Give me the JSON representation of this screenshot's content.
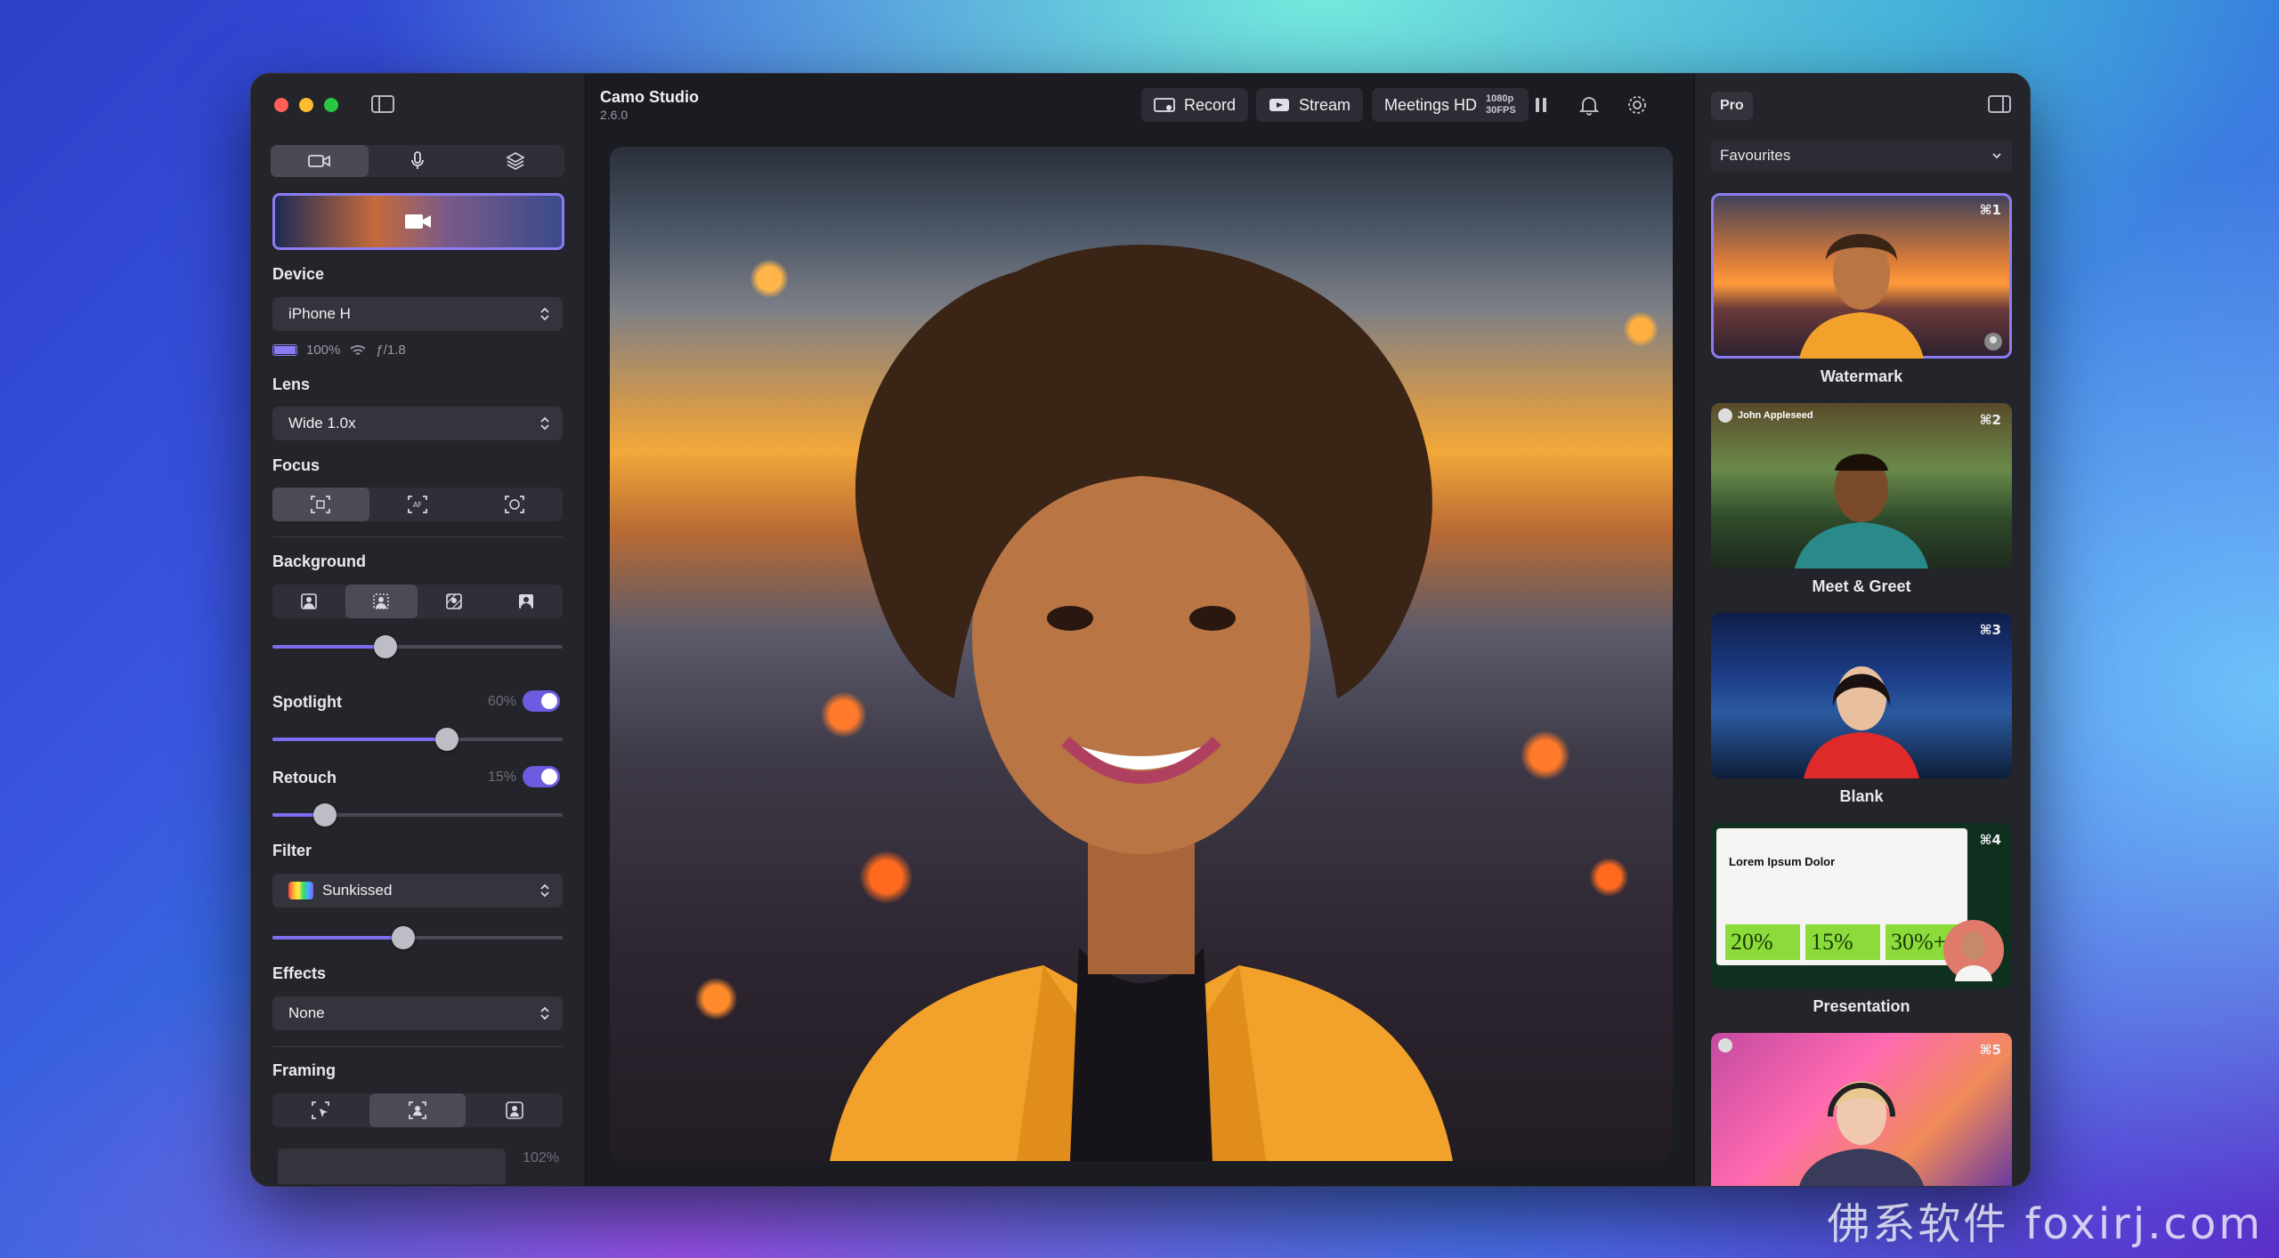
{
  "app": {
    "title": "Camo Studio",
    "version": "2.6.0"
  },
  "sidebar": {
    "tabs": [
      {
        "icon": "video-camera-icon",
        "active": true
      },
      {
        "icon": "microphone-icon",
        "active": false
      },
      {
        "icon": "layers-icon",
        "active": false
      }
    ],
    "device": {
      "label": "Device",
      "value": "iPhone H",
      "battery": "100%",
      "aperture": "ƒ/1.8"
    },
    "lens": {
      "label": "Lens",
      "value": "Wide 1.0x"
    },
    "focus": {
      "label": "Focus",
      "modes": [
        "focus-auto-icon",
        "focus-af-icon",
        "focus-face-icon"
      ],
      "selected": 0
    },
    "background": {
      "label": "Background",
      "modes": [
        "portrait-icon",
        "blur-icon",
        "replace-icon",
        "person-solid-icon"
      ],
      "selected": 1,
      "level": 0.39
    },
    "spotlight": {
      "label": "Spotlight",
      "value": "60%",
      "enabled": true,
      "level": 0.6
    },
    "retouch": {
      "label": "Retouch",
      "value": "15%",
      "enabled": true,
      "level": 0.18
    },
    "filter": {
      "label": "Filter",
      "value": "Sunkissed",
      "level": 0.45
    },
    "effects": {
      "label": "Effects",
      "value": "None"
    },
    "framing": {
      "label": "Framing",
      "modes": [
        "framing-pointer-icon",
        "framing-center-icon",
        "framing-person-icon"
      ],
      "selected": 1,
      "zoom": "102%"
    }
  },
  "toolbar": {
    "record_label": "Record",
    "stream_label": "Stream",
    "output_label": "Meetings HD",
    "output_resolution": "1080p",
    "output_fps": "30FPS"
  },
  "right_panel": {
    "badge": "Pro",
    "preset_group": "Favourites",
    "scenes": [
      {
        "name": "Watermark",
        "shortcut": "⌘1",
        "selected": true
      },
      {
        "name": "Meet & Greet",
        "shortcut": "⌘2",
        "selected": false,
        "overlay_name": "John Appleseed"
      },
      {
        "name": "Blank",
        "shortcut": "⌘3",
        "selected": false
      },
      {
        "name": "Presentation",
        "shortcut": "⌘4",
        "selected": false,
        "slide_title": "Lorem Ipsum Dolor",
        "stats": [
          "20%",
          "15%",
          "30%+"
        ]
      },
      {
        "name": "",
        "shortcut": "⌘5",
        "selected": false
      }
    ]
  },
  "colors": {
    "accent": "#7d6df0",
    "window_bg": "#1b1b22",
    "panel_bg": "#24242b"
  },
  "watermark": "佛系软件 foxirj.com"
}
